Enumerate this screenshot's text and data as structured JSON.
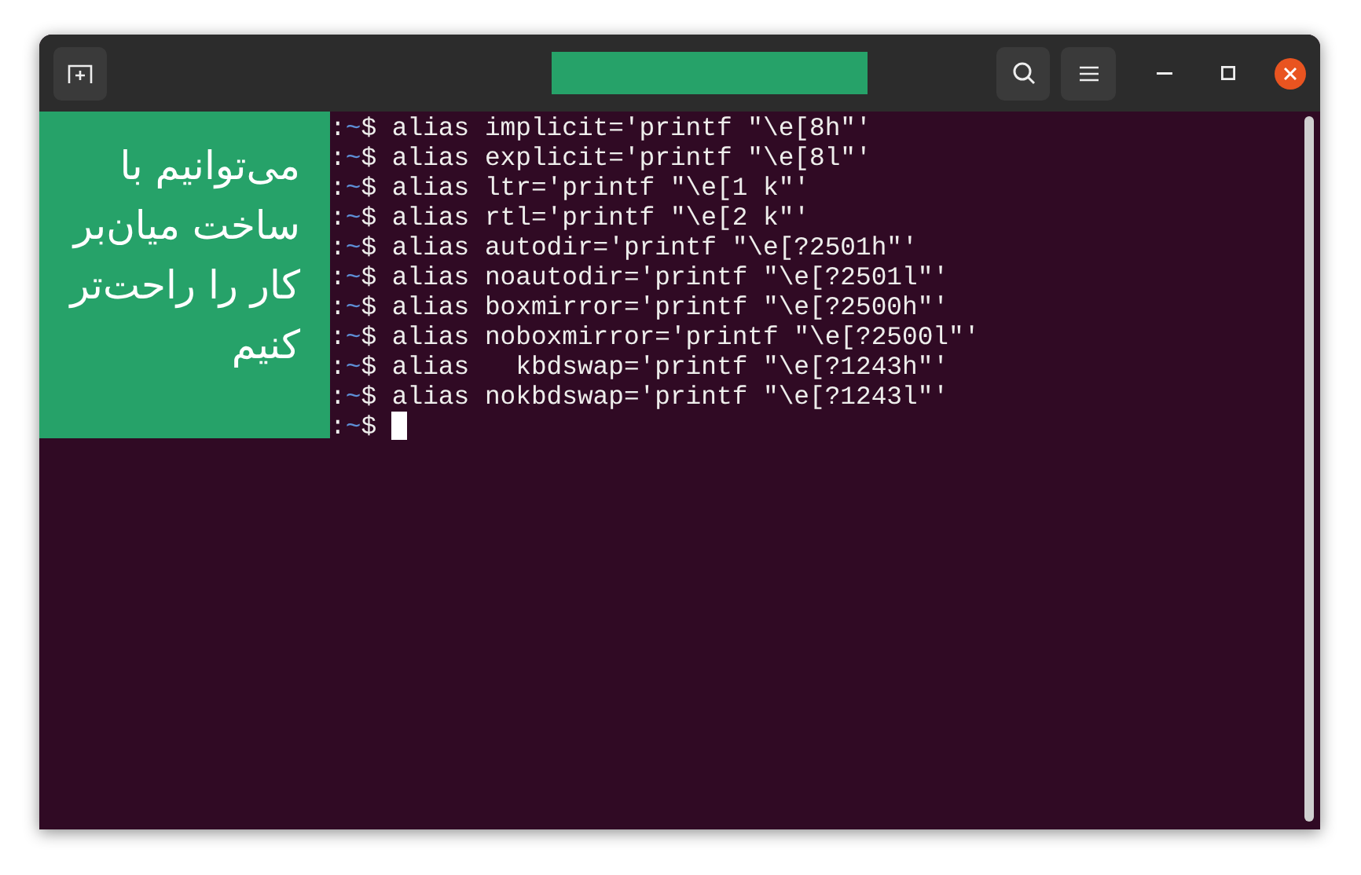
{
  "overlay_note": {
    "lines": [
      "می‌توانیم با",
      "ساخت میان‌بر",
      "کار را راحت‌تر",
      "کنیم"
    ]
  },
  "terminal": {
    "lines": [
      {
        "colon": ":",
        "path": "~",
        "sign": "$",
        "command": "alias implicit='printf \"\\e[8h\"'"
      },
      {
        "colon": ":",
        "path": "~",
        "sign": "$",
        "command": "alias explicit='printf \"\\e[8l\"'"
      },
      {
        "colon": ":",
        "path": "~",
        "sign": "$",
        "command": "alias ltr='printf \"\\e[1 k\"'"
      },
      {
        "colon": ":",
        "path": "~",
        "sign": "$",
        "command": "alias rtl='printf \"\\e[2 k\"'"
      },
      {
        "colon": ":",
        "path": "~",
        "sign": "$",
        "command": "alias autodir='printf \"\\e[?2501h\"'"
      },
      {
        "colon": ":",
        "path": "~",
        "sign": "$",
        "command": "alias noautodir='printf \"\\e[?2501l\"'"
      },
      {
        "colon": ":",
        "path": "~",
        "sign": "$",
        "command": "alias boxmirror='printf \"\\e[?2500h\"'"
      },
      {
        "colon": ":",
        "path": "~",
        "sign": "$",
        "command": "alias noboxmirror='printf \"\\e[?2500l\"'"
      },
      {
        "colon": ":",
        "path": "~",
        "sign": "$",
        "command": "alias   kbdswap='printf \"\\e[?1243h\"'"
      },
      {
        "colon": ":",
        "path": "~",
        "sign": "$",
        "command": "alias nokbdswap='printf \"\\e[?1243l\"'"
      },
      {
        "colon": ":",
        "path": "~",
        "sign": "$",
        "cursor": true
      }
    ]
  }
}
